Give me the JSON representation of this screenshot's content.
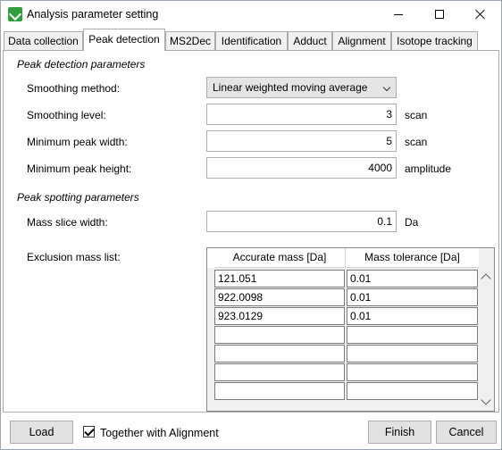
{
  "window": {
    "title": "Analysis parameter setting"
  },
  "tabs": [
    {
      "label": "Data collection"
    },
    {
      "label": "Peak detection"
    },
    {
      "label": "MS2Dec"
    },
    {
      "label": "Identification"
    },
    {
      "label": "Adduct"
    },
    {
      "label": "Alignment"
    },
    {
      "label": "Isotope tracking"
    }
  ],
  "active_tab": "Peak detection",
  "peak_detection": {
    "section_title": "Peak detection parameters",
    "smoothing_method": {
      "label": "Smoothing method:",
      "value": "Linear weighted moving average"
    },
    "smoothing_level": {
      "label": "Smoothing level:",
      "value": "3",
      "unit": "scan"
    },
    "min_peak_width": {
      "label": "Minimum peak width:",
      "value": "5",
      "unit": "scan"
    },
    "min_peak_height": {
      "label": "Minimum peak height:",
      "value": "4000",
      "unit": "amplitude"
    }
  },
  "peak_spotting": {
    "section_title": "Peak spotting parameters",
    "mass_slice_width": {
      "label": "Mass slice width:",
      "value": "0.1",
      "unit": "Da"
    },
    "exclusion_label": "Exclusion mass list:",
    "columns": [
      "Accurate mass [Da]",
      "Mass tolerance [Da]"
    ],
    "rows": [
      [
        "121.051",
        "0.01"
      ],
      [
        "922.0098",
        "0.01"
      ],
      [
        "923.0129",
        "0.01"
      ],
      [
        "",
        ""
      ],
      [
        "",
        ""
      ],
      [
        "",
        ""
      ],
      [
        "",
        ""
      ]
    ]
  },
  "footer": {
    "load_label": "Load",
    "together_label": "Together with Alignment",
    "together_checked": true,
    "finish_label": "Finish",
    "cancel_label": "Cancel"
  },
  "icons": {
    "app": "app-logo-icon",
    "minimize": "minimize-icon",
    "maximize": "maximize-icon",
    "close": "close-icon"
  }
}
